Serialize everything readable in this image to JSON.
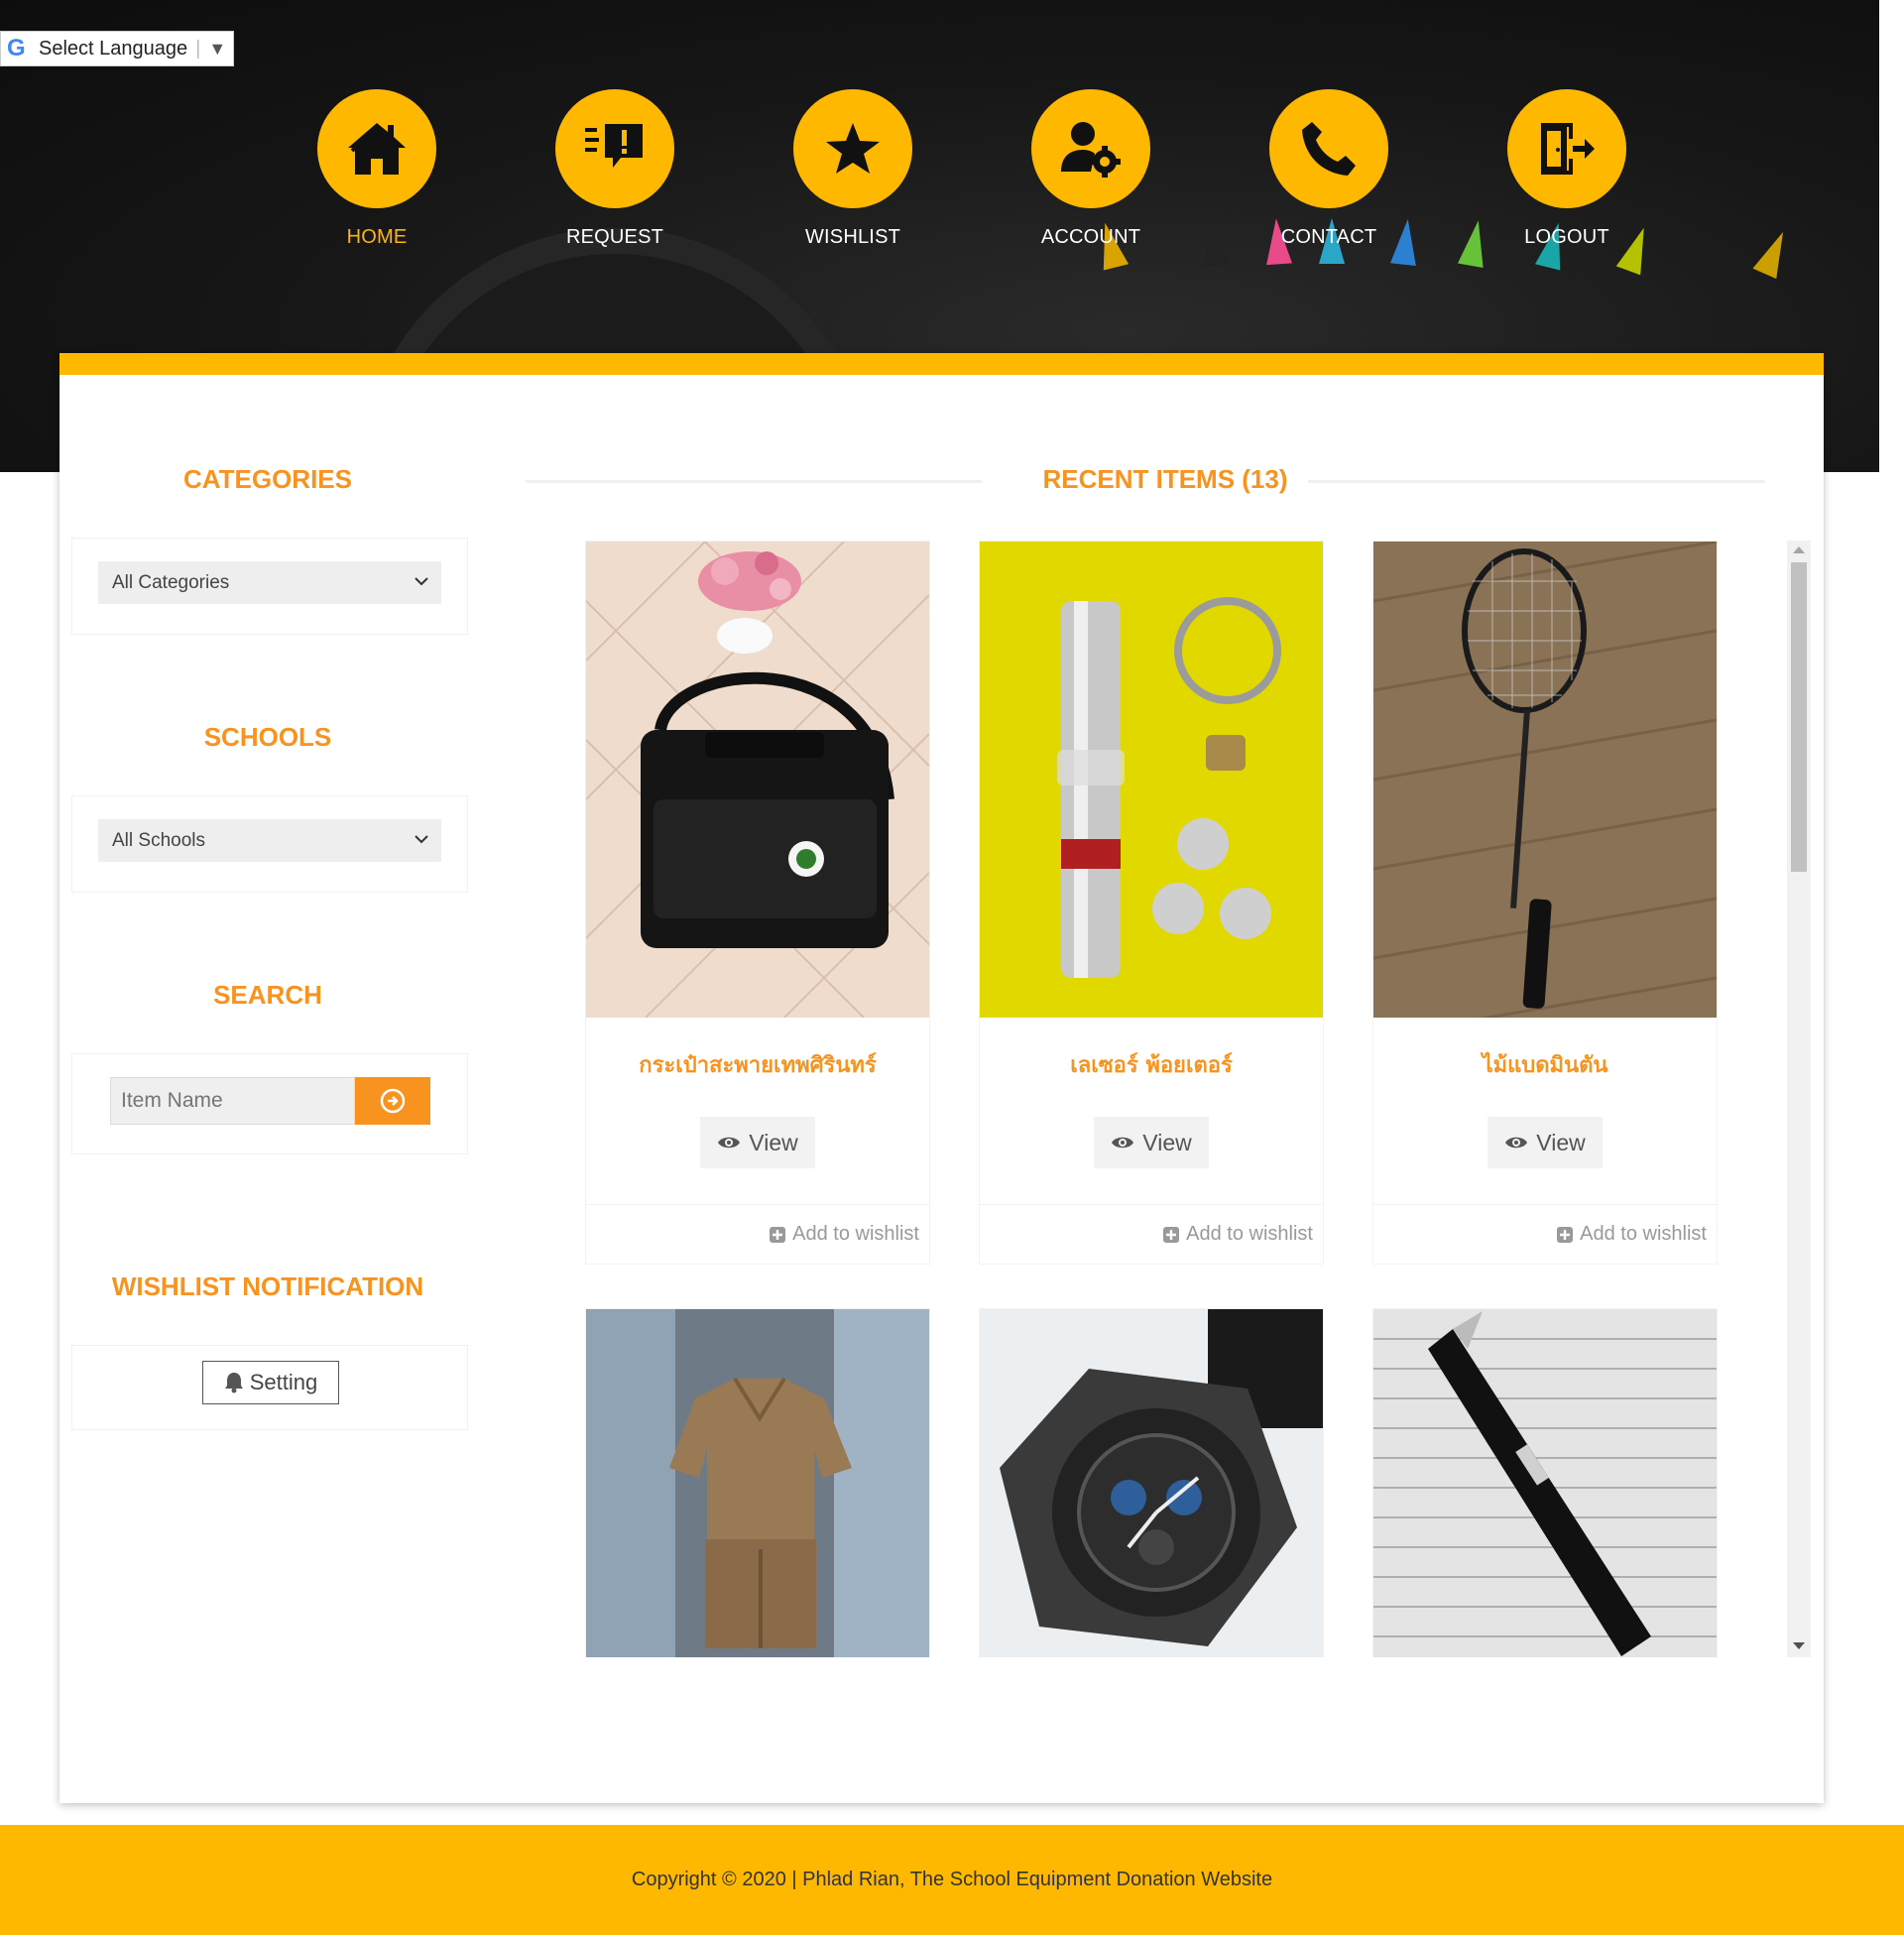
{
  "language_widget": {
    "label": "Select Language"
  },
  "nav": [
    {
      "label": "HOME",
      "icon": "home-icon",
      "active": true
    },
    {
      "label": "REQUEST",
      "icon": "request-icon",
      "active": false
    },
    {
      "label": "WISHLIST",
      "icon": "star-icon",
      "active": false
    },
    {
      "label": "ACCOUNT",
      "icon": "user-cog-icon",
      "active": false
    },
    {
      "label": "CONTACT",
      "icon": "phone-icon",
      "active": false
    },
    {
      "label": "LOGOUT",
      "icon": "logout-icon",
      "active": false
    }
  ],
  "sidebar": {
    "categories_title": "CATEGORIES",
    "categories_selected": "All Categories",
    "schools_title": "SCHOOLS",
    "schools_selected": "All Schools",
    "search_title": "SEARCH",
    "search_placeholder": "Item Name",
    "wishlist_title": "WISHLIST NOTIFICATION",
    "setting_label": "Setting"
  },
  "recent": {
    "title": "RECENT ITEMS (13)",
    "view_label": "View",
    "wishlist_label": "Add to wishlist",
    "items": [
      {
        "name": "กระเป๋าสะพายเทพศิรินทร์",
        "image": "black-shoulder-bag"
      },
      {
        "name": "เลเซอร์ พ้อยเตอร์",
        "image": "laser-pointer"
      },
      {
        "name": "ไม้แบดมินตัน",
        "image": "badminton-racket"
      },
      {
        "name": "",
        "image": "khaki-uniform"
      },
      {
        "name": "",
        "image": "gshock-watch"
      },
      {
        "name": "",
        "image": "black-pen"
      }
    ]
  },
  "footer": {
    "copyright": "Copyright © 2020 | Phlad Rian, The School Equipment Donation Website"
  },
  "colors": {
    "accent": "#ffb800",
    "orange": "#f7931e",
    "hero_bg": "#151515"
  }
}
